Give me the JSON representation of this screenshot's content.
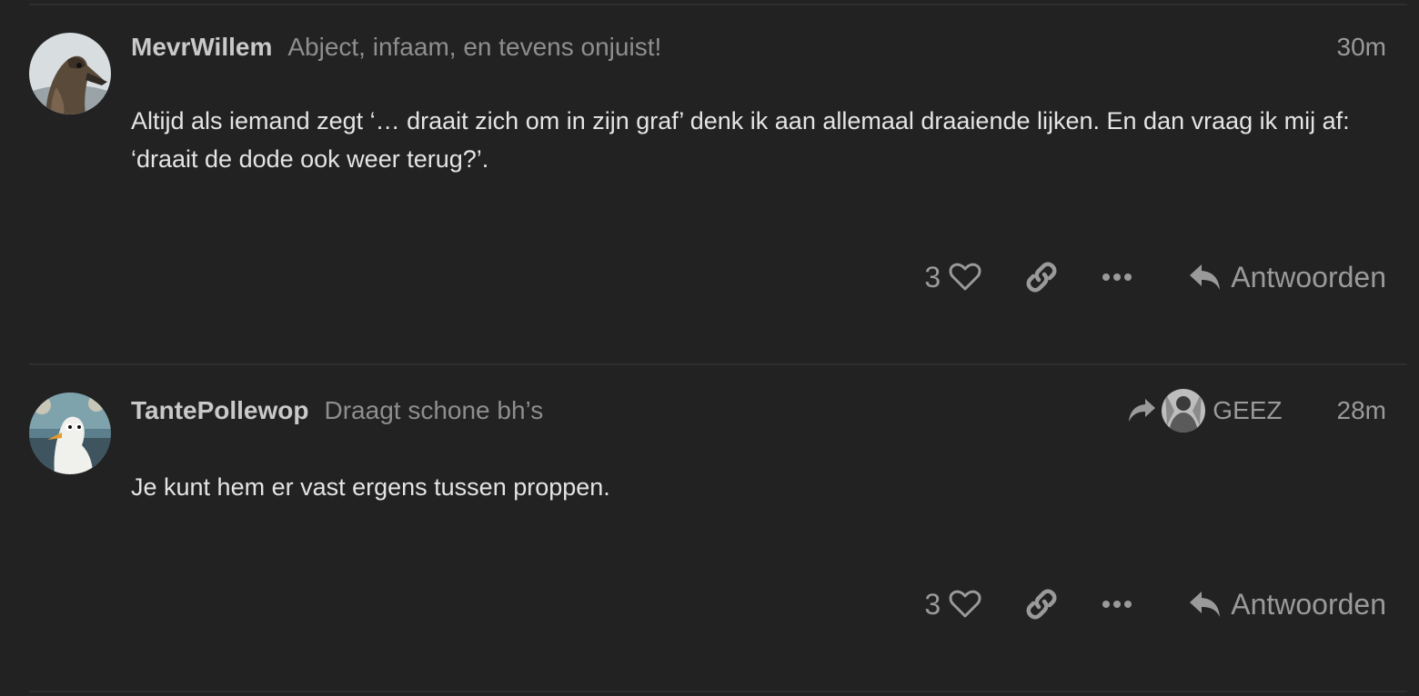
{
  "posts": [
    {
      "username": "MevrWillem",
      "user_title": "Abject, infaam, en tevens onjuist!",
      "timestamp": "30m",
      "body": "Altijd als iemand zegt ‘… draait zich om in zijn graf’ denk ik aan allemaal draaiende lijken. En dan vraag ik mij af: ‘draait de dode ook weer terug?’.",
      "likes": "3",
      "reply_label": "Antwoorden",
      "avatar_icon": "duck-avatar"
    },
    {
      "username": "TantePollewop",
      "user_title": "Draagt schone bh’s",
      "timestamp": "28m",
      "reply_to": "GEEZ",
      "body": "Je kunt hem er vast ergens tussen proppen.",
      "likes": "3",
      "reply_label": "Antwoorden",
      "avatar_icon": "seagull-avatar"
    }
  ],
  "colors": {
    "background": "#222222",
    "divider": "#2e2e2e",
    "muted": "#9a9a9a",
    "text": "#e4e4e4"
  }
}
